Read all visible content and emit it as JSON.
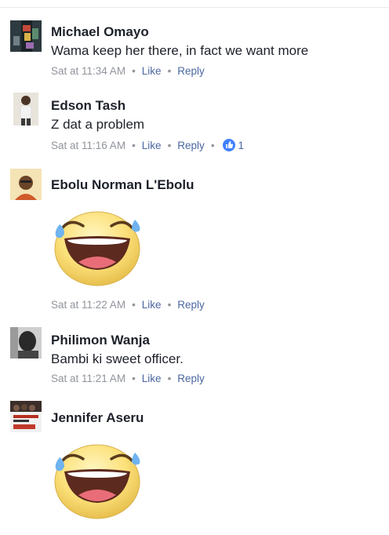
{
  "comments": [
    {
      "name": "Michael Omayo",
      "text": "Wama keep her there, in fact we want more",
      "time": "Sat at 11:34 AM",
      "like": "Like",
      "reply": "Reply"
    },
    {
      "name": "Edson Tash",
      "text": "Z dat a problem",
      "time": "Sat at 11:16 AM",
      "like": "Like",
      "reply": "Reply",
      "reactions": "1",
      "reaction_icon": "like-thumbs-up-icon"
    },
    {
      "name": "Ebolu Norman L'Ebolu",
      "sticker": "laughing-tears-sticker",
      "time": "Sat at 11:22 AM",
      "like": "Like",
      "reply": "Reply"
    },
    {
      "name": "Philimon Wanja",
      "text": "Bambi ki sweet officer.",
      "time": "Sat at 11:21 AM",
      "like": "Like",
      "reply": "Reply"
    },
    {
      "name": "Jennifer Aseru",
      "sticker": "laughing-tears-sticker"
    }
  ],
  "colors": {
    "link": "#4b67a1",
    "meta": "#90949c",
    "text": "#1d2129",
    "like_badge": "#4080ff"
  }
}
